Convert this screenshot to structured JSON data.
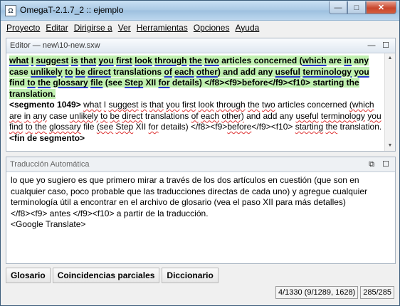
{
  "window": {
    "title": "OmegaT-2.1.7_2 :: ejemplo",
    "app_icon_text": "Ω",
    "controls": {
      "minimize": "—",
      "maximize": "□",
      "close": "✕"
    }
  },
  "menu": [
    "Proyecto",
    "Editar",
    "Dirigirse a",
    "Ver",
    "Herramientas",
    "Opciones",
    "Ayuda"
  ],
  "editor": {
    "title": "Editor — new\\10-new.sxw",
    "btn_minimize": "—",
    "btn_maximize": "☐",
    "source": {
      "w1": "what",
      "w2": "I",
      "w3": "suggest",
      "w4": "is",
      "w5": "that",
      "w6": "you",
      "w7": "first",
      "w8": "look",
      "w9": "through",
      "w10": "the",
      "w11": "two",
      "w12": "articles",
      "w13": "concerned",
      "w14": "(",
      "w15": "which",
      "w16": "are",
      "w17": "in",
      "w18": "any",
      "w19": "case",
      "w20": "unlikely",
      "w21": "to",
      "w22": "be",
      "w23": "direct",
      "w24": "translations",
      "w25": "of",
      "w26": "each",
      "w27": "other",
      "w28": ")",
      "w29": "and",
      "w30": "add",
      "w31": "any",
      "w32": "useful",
      "w33": "terminology",
      "w34": "you",
      "w35": "find",
      "w36": "to",
      "w37": "the",
      "w38": "glossary",
      "w39": "file",
      "w40": "(see",
      "w41": "Step",
      "w42": "XII",
      "w43": "for",
      "w44": "details)",
      "w45": "</f8><f9>before</f9><f10>",
      "w46": "starting",
      "w47": "the",
      "w48": "translation."
    },
    "segment_marker": "<segmento 1049>",
    "target": {
      "t1": "what",
      "t2": "I",
      "t3": "suggest",
      "t4": "is",
      "t5": "that",
      "t6": "you",
      "t7": "first",
      "t8": "look",
      "t9": "through",
      "t10": "the",
      "t11": "two",
      "t12": "articles",
      "t13": "concerned",
      "t14": "(which",
      "t15": "are",
      "t16": "in",
      "t17": "any",
      "t18": "case",
      "t19": "unlikely",
      "t20": "to",
      "t21": "be",
      "t22": "direct",
      "t23": "translations",
      "t24": "of",
      "t25": "each",
      "t26": "other)",
      "t27": "and",
      "t28": "add",
      "t29": "any",
      "t30": "useful",
      "t31": "terminology",
      "t32": "you",
      "t33": "find",
      "t34": "to",
      "t35": "the",
      "t36": "glossary",
      "t37": "file",
      "t38": "(see",
      "t39": "Step",
      "t40": "XII",
      "t41": "for",
      "t42": "details)",
      "t43": "</f8><f9>",
      "t44": "before",
      "t45": "</f9><f10>",
      "t46": "starting",
      "t47": "the",
      "t48": "translation."
    },
    "end_marker": "<fin de segmento>"
  },
  "machine_translation": {
    "title": "Traducción Automática",
    "btn_undock": "⧉",
    "btn_maximize": "☐",
    "lines": [
      "lo que yo sugiero es que primero mirar a través de los dos artículos en cuestión (que son en",
      "cualquier caso, poco probable que las traducciones directas de cada uno) y agregue cualquier",
      "terminología útil a encontrar en el archivo de glosario (vea el paso XII para más detalles)",
      "</f8><f9> antes </f9><f10> a partir de la traducción.",
      "<Google Translate>"
    ]
  },
  "tabs": [
    "Glosario",
    "Coincidencias parciales",
    "Diccionario"
  ],
  "status": {
    "progress": "4/1330 (9/1289, 1628)",
    "chars": "285/285"
  }
}
